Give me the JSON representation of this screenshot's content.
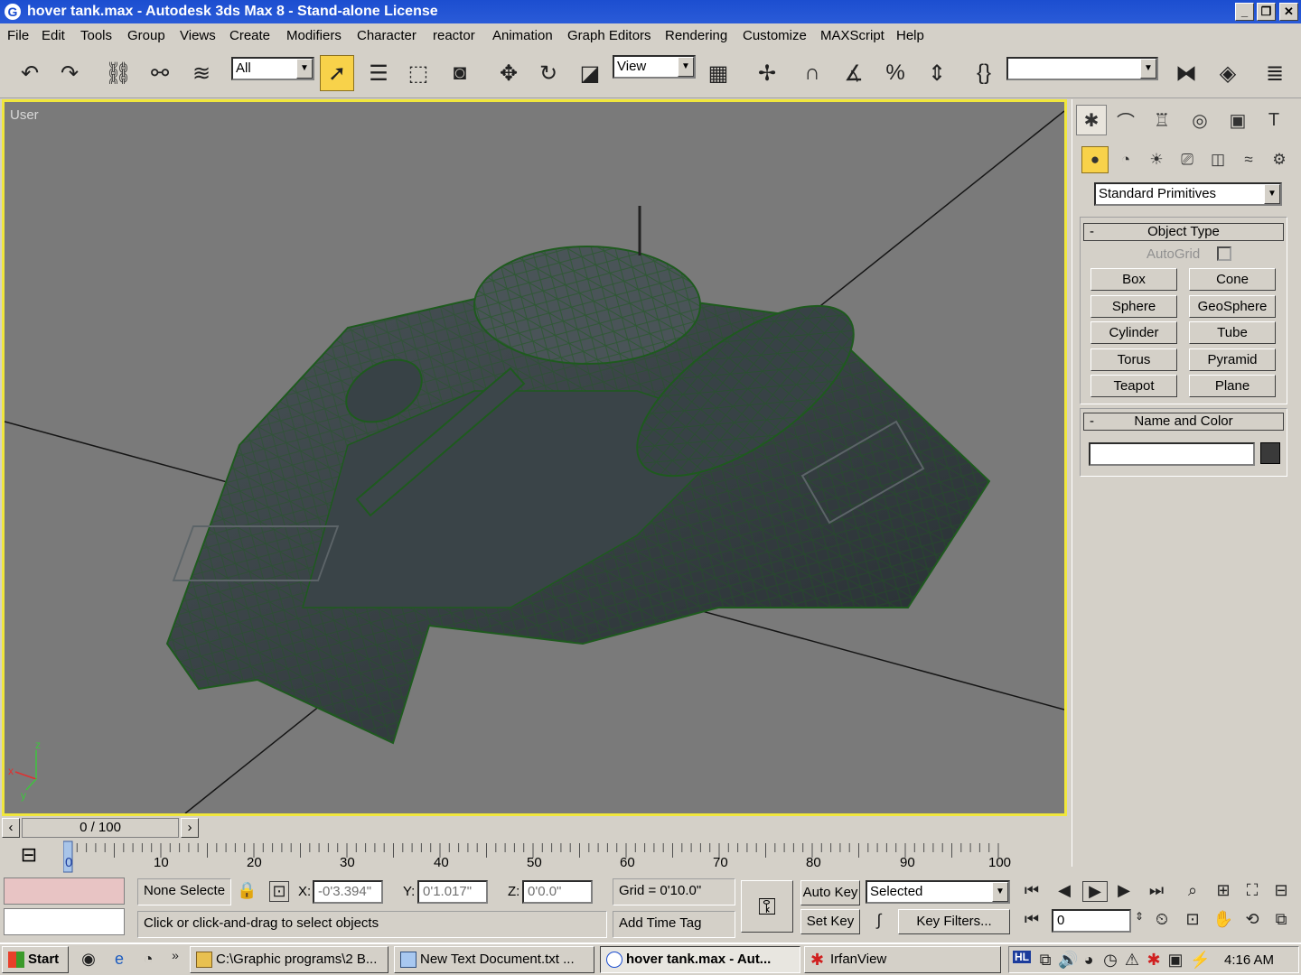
{
  "window": {
    "title": "hover tank.max - Autodesk 3ds Max 8  - Stand-alone License",
    "min": "_",
    "max": "❐",
    "close": "✕"
  },
  "menu": [
    "File",
    "Edit",
    "Tools",
    "Group",
    "Views",
    "Create",
    "Modifiers",
    "Character",
    "reactor",
    "Animation",
    "Graph Editors",
    "Rendering",
    "Customize",
    "MAXScript",
    "Help"
  ],
  "toolbar": {
    "selection_filter": "All",
    "reference_coord": "View",
    "named_selection": ""
  },
  "viewport": {
    "label": "User",
    "axis_x": "x",
    "axis_y": "y",
    "axis_z": "z",
    "colors": {
      "border": "#f0e63c",
      "background": "#7a7a7a",
      "wire": "#1e5a1e"
    }
  },
  "command_panel": {
    "category": "Standard Primitives",
    "object_type_title": "Object Type",
    "autogrid": "AutoGrid",
    "buttons": [
      "Box",
      "Cone",
      "Sphere",
      "GeoSphere",
      "Cylinder",
      "Tube",
      "Torus",
      "Pyramid",
      "Teapot",
      "Plane"
    ],
    "name_color_title": "Name and Color",
    "name_value": "",
    "collapse": "-"
  },
  "timeline": {
    "frame_display": "0 / 100",
    "ticks": [
      "0",
      "10",
      "20",
      "30",
      "40",
      "50",
      "60",
      "70",
      "80",
      "90",
      "100"
    ]
  },
  "status": {
    "selection": "None Selecte",
    "x_label": "X:",
    "x_value": "-0'3.394\"",
    "y_label": "Y:",
    "y_value": "0'1.017\"",
    "z_label": "Z:",
    "z_value": "0'0.0\"",
    "grid": "Grid = 0'10.0\"",
    "prompt": "Click or click-and-drag to select objects",
    "add_time_tag": "Add Time Tag",
    "auto_key": "Auto Key",
    "set_key": "Set Key",
    "key_mode": "Selected",
    "key_filters": "Key Filters...",
    "current_frame": "0"
  },
  "taskbar": {
    "start": "Start",
    "tasks": [
      "C:\\Graphic programs\\2 B...",
      "New Text Document.txt ...",
      "hover tank.max - Aut...",
      "IrfanView"
    ],
    "clock": "4:16 AM"
  }
}
